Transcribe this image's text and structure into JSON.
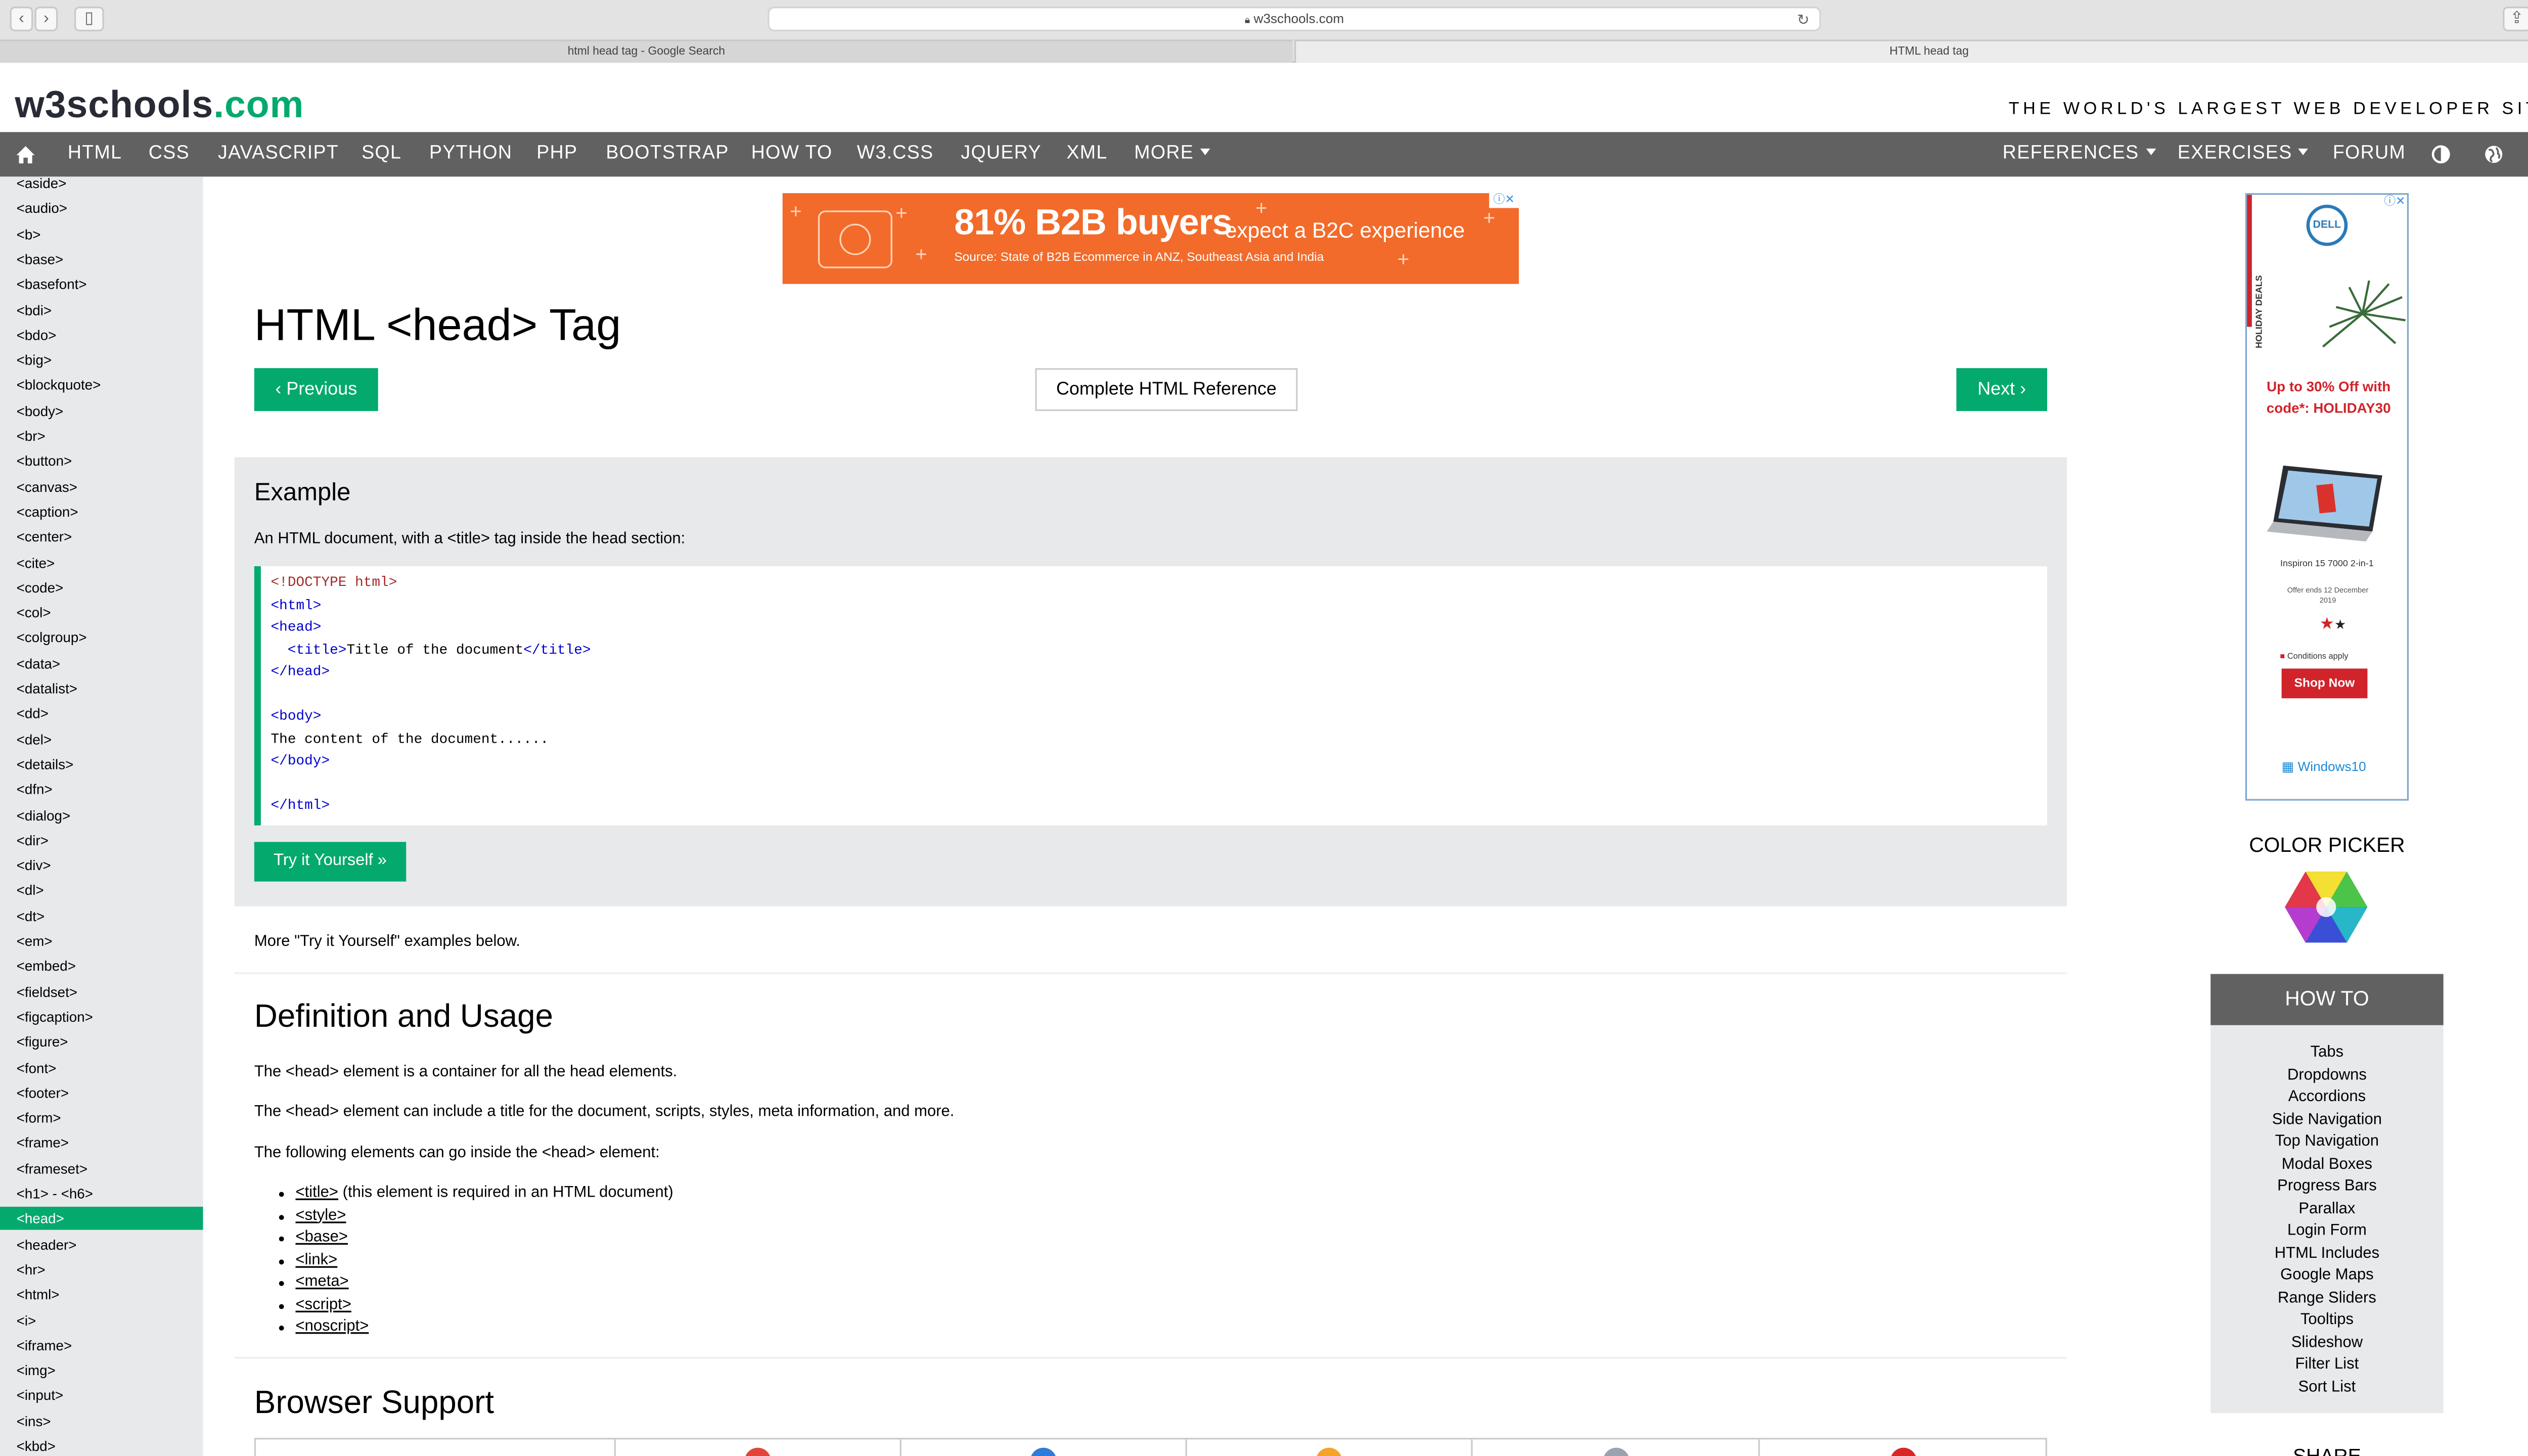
{
  "browser": {
    "url": "w3schools.com",
    "tabs": [
      "html head tag - Google Search",
      "HTML head tag"
    ]
  },
  "header": {
    "logo_main": "w3schools",
    "logo_suffix": ".com",
    "slogan": "THE WORLD'S LARGEST WEB DEVELOPER SITE"
  },
  "topnav": {
    "left": [
      "HTML",
      "CSS",
      "JAVASCRIPT",
      "SQL",
      "PYTHON",
      "PHP",
      "BOOTSTRAP",
      "HOW TO",
      "W3.CSS",
      "JQUERY",
      "XML",
      "MORE"
    ],
    "right": [
      "REFERENCES",
      "EXERCISES",
      "FORUM"
    ]
  },
  "sidebar": {
    "items": [
      "<aside>",
      "<audio>",
      "<b>",
      "<base>",
      "<basefont>",
      "<bdi>",
      "<bdo>",
      "<big>",
      "<blockquote>",
      "<body>",
      "<br>",
      "<button>",
      "<canvas>",
      "<caption>",
      "<center>",
      "<cite>",
      "<code>",
      "<col>",
      "<colgroup>",
      "<data>",
      "<datalist>",
      "<dd>",
      "<del>",
      "<details>",
      "<dfn>",
      "<dialog>",
      "<dir>",
      "<div>",
      "<dl>",
      "<dt>",
      "<em>",
      "<embed>",
      "<fieldset>",
      "<figcaption>",
      "<figure>",
      "<font>",
      "<footer>",
      "<form>",
      "<frame>",
      "<frameset>",
      "<h1> - <h6>",
      "<head>",
      "<header>",
      "<hr>",
      "<html>",
      "<i>",
      "<iframe>",
      "<img>",
      "<input>",
      "<ins>",
      "<kbd>"
    ],
    "active": "<head>"
  },
  "banner_ad": {
    "headline": "81% B2B buyers",
    "tagline": "expect a B2C experience",
    "source": "Source: State of B2B Ecommerce in ANZ, Southeast Asia and India",
    "accent": "#f26b2a"
  },
  "main": {
    "title": "HTML <head> Tag",
    "prev_label": "Previous",
    "ref_label": "Complete HTML Reference",
    "next_label": "Next",
    "example_heading": "Example",
    "example_desc": "An HTML document, with a <title> tag inside the head section:",
    "try_label": "Try it Yourself »",
    "more_examples": "More \"Try it Yourself\" examples below.",
    "def_heading": "Definition and Usage",
    "def_p1": "The <head> element is a container for all the head elements.",
    "def_p2": "The <head> element can include a title for the document, scripts, styles, meta information, and more.",
    "def_p3": "The following elements can go inside the <head> element:",
    "list": [
      "<title>",
      "<style>",
      "<base>",
      "<link>",
      "<meta>",
      "<script>",
      "<noscript>"
    ],
    "list_note": "(this element is required in an HTML document)",
    "browser_heading": "Browser Support"
  },
  "code": {
    "doctype": "<!DOCTYPE html>",
    "html_open": "<html>",
    "head_open": "<head>",
    "title_open": "<title>",
    "title_text": "Title of the document",
    "title_close": "</title>",
    "head_close": "</head>",
    "body_open": "<body>",
    "body_text": "The content of the document......",
    "body_close": "</body>",
    "html_close": "</html>"
  },
  "side_ad": {
    "brand": "DELL",
    "vertical_label": "HOLIDAY DEALS",
    "offer": "Up to 30% Off with code*: HOLIDAY30",
    "product": "Inspiron 15 7000 2-in-1",
    "offer_ends": "Offer ends 12 December 2019",
    "conditions": "Conditions apply",
    "cta": "Shop Now",
    "os": "Windows10"
  },
  "right": {
    "color_picker": "COLOR PICKER",
    "howto_heading": "HOW TO",
    "howto_items": [
      "Tabs",
      "Dropdowns",
      "Accordions",
      "Side Navigation",
      "Top Navigation",
      "Modal Boxes",
      "Progress Bars",
      "Parallax",
      "Login Form",
      "HTML Includes",
      "Google Maps",
      "Range Sliders",
      "Tooltips",
      "Slideshow",
      "Filter List",
      "Sort List"
    ],
    "share_heading": "SHARE"
  },
  "colors": {
    "green": "#04aa6d",
    "nav": "#616161",
    "sidebar": "#e7e9eb",
    "ad_red": "#d1232a"
  }
}
